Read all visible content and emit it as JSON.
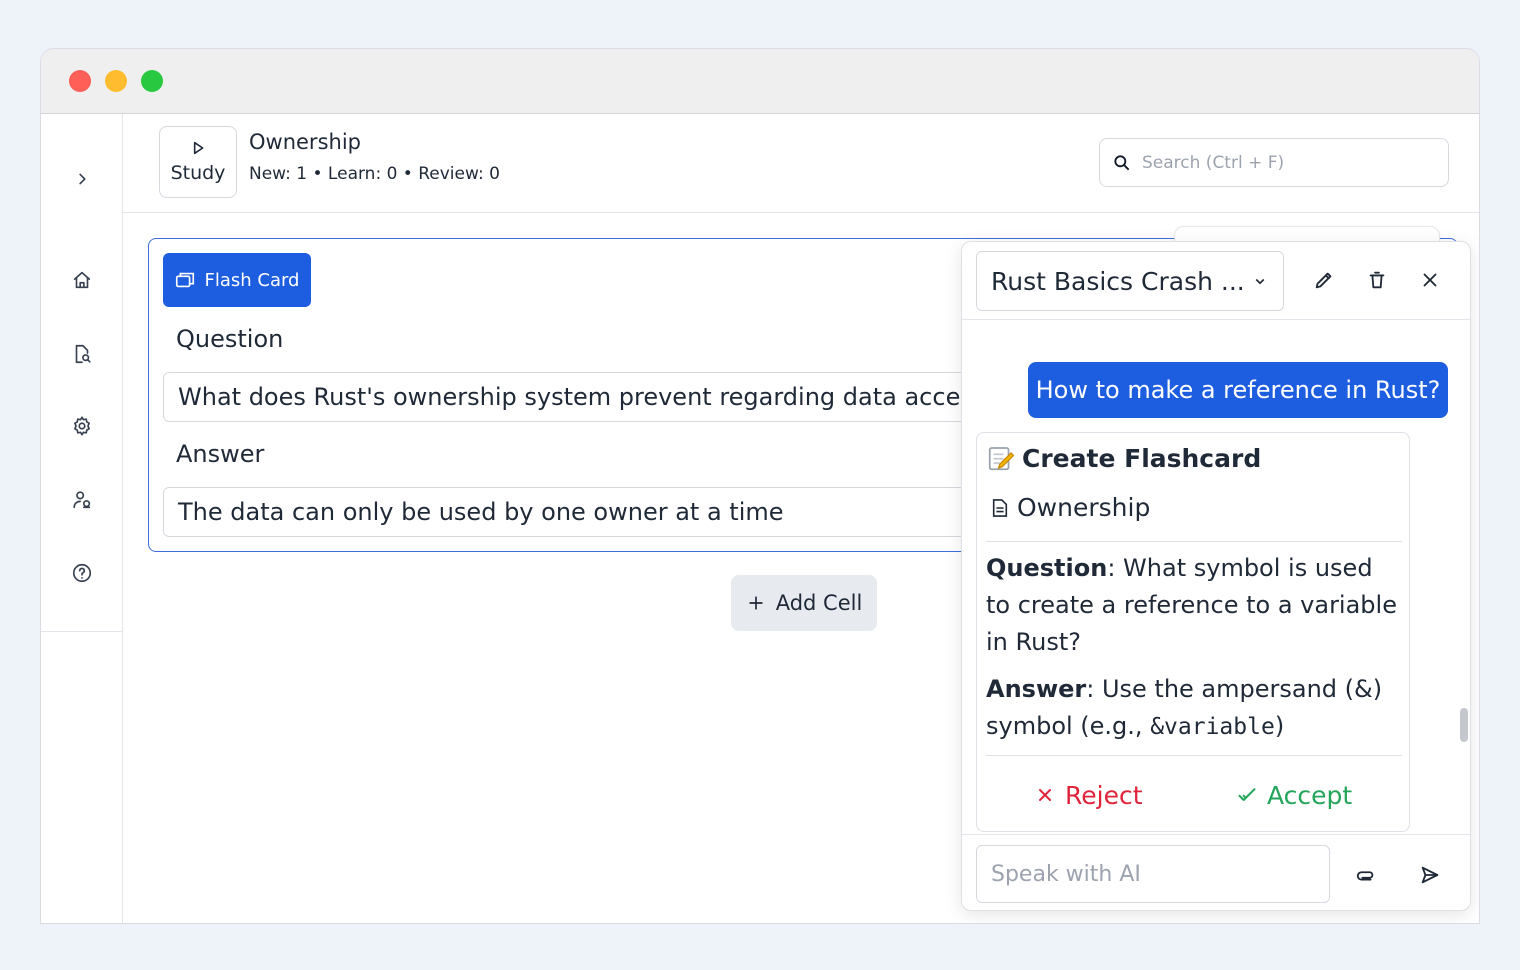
{
  "header": {
    "study_label": "Study",
    "deck_title": "Ownership",
    "stats": "New: 1 • Learn: 0 • Review: 0",
    "search_placeholder": "Search (Ctrl + F)"
  },
  "card": {
    "type_label": "Flash Card",
    "question_label": "Question",
    "question_value": "What does Rust's ownership system prevent regarding data access?",
    "answer_label": "Answer",
    "answer_value": "The data can only be used by one owner at a time"
  },
  "add_cell_label": "Add Cell",
  "chat": {
    "deck_select_value": "Rust Basics Crash ...",
    "user_message": "How to make a reference in Rust?",
    "ai_card": {
      "title": "Create Flashcard",
      "deck": "Ownership",
      "question_label": "Question",
      "question_text": ": What symbol is used to create a reference to a variable in Rust?",
      "answer_label": "Answer",
      "answer_text": ": Use the ampersand (&) symbol (e.g., ",
      "answer_code": "&variable",
      "answer_tail": ")",
      "reject_label": "Reject",
      "accept_label": "Accept"
    },
    "input_placeholder": "Speak with AI"
  },
  "colors": {
    "accent": "#1d5ddf",
    "reject": "#e0243c",
    "accept": "#23a55a"
  },
  "icons": [
    "chevron-right-icon",
    "home-icon",
    "file-search-icon",
    "gear-icon",
    "users-icon",
    "help-icon",
    "play-icon",
    "search-icon",
    "cards-icon",
    "plus-icon",
    "chevron-down-icon",
    "pencil-icon",
    "trash-icon",
    "close-icon",
    "memo-icon",
    "document-icon",
    "x-icon",
    "check-icon",
    "paperclip-icon",
    "send-icon"
  ]
}
